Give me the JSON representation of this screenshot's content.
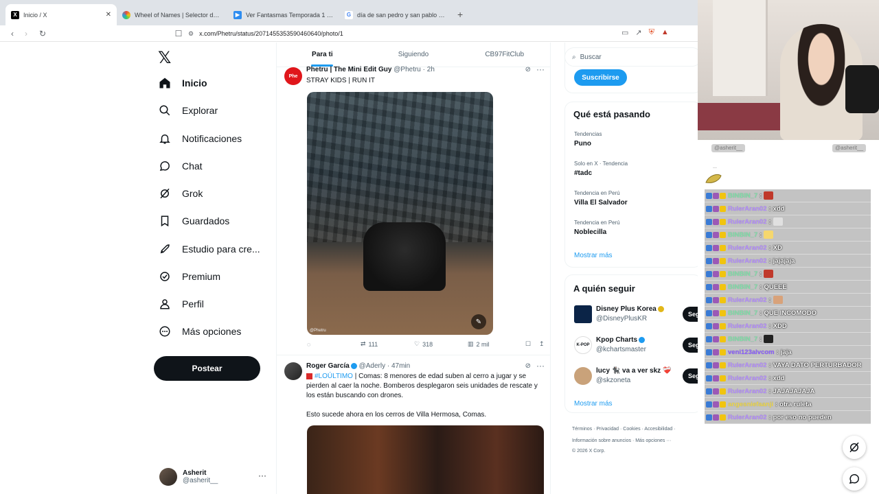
{
  "browser": {
    "tabs": [
      {
        "title": "Inicio / X",
        "favicon_color": "#000000",
        "favicon_glyph": "X",
        "active": true
      },
      {
        "title": "Wheel of Names | Selector de nombre",
        "favicon_color": "#e84b3c",
        "favicon_glyph": "",
        "active": false
      },
      {
        "title": "Ver Fantasmas Temporada 1 Episodio",
        "favicon_color": "#2d8cf0",
        "favicon_glyph": "",
        "active": false
      },
      {
        "title": "día de san pedro y san pablo - Busca",
        "favicon_color": "#4285f4",
        "favicon_glyph": "G",
        "active": false
      }
    ],
    "new_tab": "+",
    "url": "x.com/Phetru/status/2071455353590460640/photo/1"
  },
  "nav": {
    "items": [
      {
        "label": "Inicio",
        "icon": "home-icon",
        "bold": true
      },
      {
        "label": "Explorar",
        "icon": "search-icon"
      },
      {
        "label": "Notificaciones",
        "icon": "bell-icon"
      },
      {
        "label": "Chat",
        "icon": "chat-icon"
      },
      {
        "label": "Grok",
        "icon": "grok-icon"
      },
      {
        "label": "Guardados",
        "icon": "bookmark-icon"
      },
      {
        "label": "Estudio para cre...",
        "icon": "rocket-icon"
      },
      {
        "label": "Premium",
        "icon": "premium-icon"
      },
      {
        "label": "Perfil",
        "icon": "person-icon"
      },
      {
        "label": "Más opciones",
        "icon": "more-circle-icon"
      }
    ],
    "post_label": "Postear",
    "account": {
      "name": "Asherit",
      "handle": "@asherit__"
    }
  },
  "feed": {
    "tabs": [
      "Para ti",
      "Siguiendo",
      "CB97FitClub"
    ],
    "tweet1": {
      "author": "Phetru | The Mini Edit Guy",
      "handle": "@Phetru · 2h",
      "text": "STRAY KIDS | RUN IT",
      "avatar_text": "Phe",
      "watermark": "@Phetru",
      "replies": "",
      "retweets": "111",
      "likes": "318",
      "views": "2 mil"
    },
    "tweet2": {
      "author": "Roger García",
      "handle": "@Aderly · 47min",
      "tag": "#LOÚLTIMO",
      "text": " | Comas: 8 menores de edad suben al cerro a jugar y se pierden al caer la noche. Bomberos desplegaron seis unidades de rescate y los están buscando con drones.",
      "text2": "Esto sucede ahora en los cerros de Villa Hermosa, Comas."
    }
  },
  "sidebar": {
    "search_placeholder": "Buscar",
    "subscribe": "Suscribirse",
    "trending_title": "Qué está pasando",
    "trends": [
      {
        "meta": "Tendencias",
        "name": "Puno"
      },
      {
        "meta": "Solo en X · Tendencia",
        "name": "#tadc"
      },
      {
        "meta": "Tendencia en Perú",
        "name": "Villa El Salvador"
      },
      {
        "meta": "Tendencia en Perú",
        "name": "Noblecilla"
      }
    ],
    "show_more": "Mostrar más",
    "follow_title": "A quién seguir",
    "follows": [
      {
        "name": "Disney Plus Korea",
        "handle": "@DisneyPlusKR",
        "badge": "gold",
        "avatar_color": "#0b2447"
      },
      {
        "name": "Kpop Charts",
        "handle": "@kchartsmaster",
        "badge": "blue",
        "avatar_color": "#ffffff"
      },
      {
        "name": "lucy 🐈‍⬛ va a ver skz ❤️‍🩹",
        "handle": "@skzoneta",
        "badge": "",
        "avatar_color": "#c9a27a"
      }
    ],
    "follow_label": "Segui",
    "show_more_2": "Mostrar más",
    "footer_line1": "Términos · Privacidad · Cookies · Accesibilidad ·",
    "footer_line2": "Información sobre anuncios · Más opciones ···",
    "footer_line3": "© 2026 X Corp."
  },
  "overlay": {
    "tag_left": "@asherit__",
    "tag_right": "@asherit__",
    "chat": [
      {
        "user": "BINBIN_7",
        "msg": "",
        "color": "#7ee0a8",
        "emote": "#c0392b"
      },
      {
        "user": "RulerAran02",
        "msg": "xdd",
        "color": "#b48cff"
      },
      {
        "user": "RulerAran02",
        "msg": "",
        "color": "#b48cff",
        "emote": "#e0e0e0"
      },
      {
        "user": "BINBIN_7",
        "msg": "",
        "color": "#7ee0a8",
        "emote": "#f5d76e"
      },
      {
        "user": "RulerAran02",
        "msg": "XD",
        "color": "#b48cff"
      },
      {
        "user": "RulerAran02",
        "msg": "jajajaja",
        "color": "#b48cff"
      },
      {
        "user": "BINBIN_7",
        "msg": "",
        "color": "#7ee0a8",
        "emote": "#c0392b"
      },
      {
        "user": "BINBIN_7",
        "msg": "QUEEE",
        "color": "#7ee0a8"
      },
      {
        "user": "RulerAran02",
        "msg": "",
        "color": "#b48cff",
        "emote": "#d8a27a"
      },
      {
        "user": "BINBIN_7",
        "msg": "QUE INCOMODO",
        "color": "#7ee0a8"
      },
      {
        "user": "RulerAran02",
        "msg": "XDD",
        "color": "#b48cff"
      },
      {
        "user": "BINBIN_7",
        "msg": "",
        "color": "#7ee0a8",
        "emote": "#222222"
      },
      {
        "user": "veni123alvcom",
        "msg": "jaja",
        "color": "#8a5cff"
      },
      {
        "user": "RulerAran02",
        "msg": "VAYA DATO PERTURBADOR",
        "color": "#b48cff"
      },
      {
        "user": "RulerAran02",
        "msg": "xdd",
        "color": "#b48cff"
      },
      {
        "user": "RulerAran02",
        "msg": "JAJAJAJAJA",
        "color": "#b48cff"
      },
      {
        "user": "angesniefaanji",
        "msg": "otra ruleta",
        "color": "#f0d94a"
      },
      {
        "user": "RulerAran02",
        "msg": "por eso no pueden",
        "color": "#b48cff"
      }
    ]
  },
  "colors": {
    "accent": "#1d9bf0",
    "text": "#0f1419",
    "muted": "#536471"
  }
}
